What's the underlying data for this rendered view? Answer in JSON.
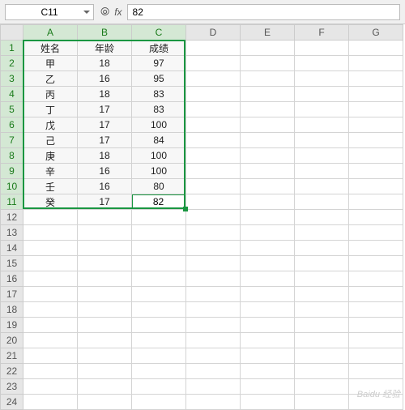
{
  "toolbar": {
    "namebox": "C11",
    "fx_symbol": "fx",
    "formula_value": "82"
  },
  "grid": {
    "col_labels": [
      "A",
      "B",
      "C",
      "D",
      "E",
      "F",
      "G"
    ],
    "row_count": 24,
    "highlighted_cols": [
      "A",
      "B",
      "C"
    ],
    "highlighted_rows": [
      1,
      2,
      3,
      4,
      5,
      6,
      7,
      8,
      9,
      10,
      11
    ],
    "active_cell": "C11",
    "active_value": "82"
  },
  "data": {
    "headers": [
      "姓名",
      "年龄",
      "成绩"
    ],
    "rows": [
      [
        "甲",
        "18",
        "97"
      ],
      [
        "乙",
        "16",
        "95"
      ],
      [
        "丙",
        "18",
        "83"
      ],
      [
        "丁",
        "17",
        "83"
      ],
      [
        "戊",
        "17",
        "100"
      ],
      [
        "己",
        "17",
        "84"
      ],
      [
        "庚",
        "18",
        "100"
      ],
      [
        "辛",
        "16",
        "100"
      ],
      [
        "壬",
        "16",
        "80"
      ],
      [
        "癸",
        "17",
        "82"
      ]
    ]
  },
  "watermark": "Baidu 经验"
}
